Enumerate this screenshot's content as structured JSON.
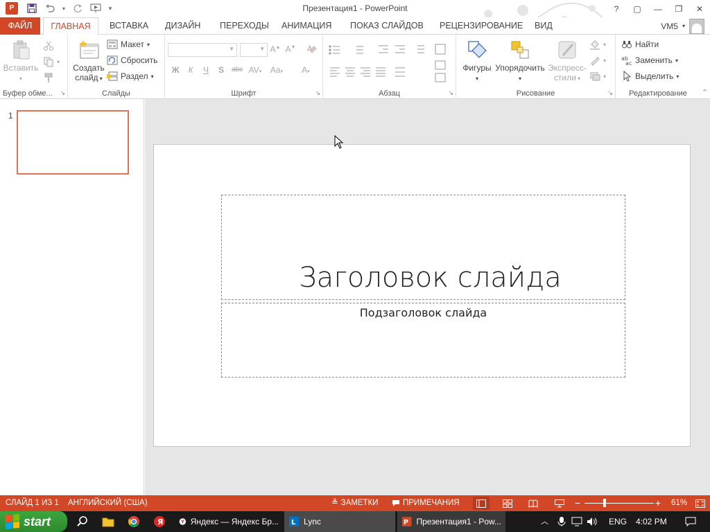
{
  "window": {
    "title": "Презентация1 - PowerPoint",
    "logo": "P",
    "controls": [
      "?",
      "▢",
      "—",
      "❐",
      "✕"
    ]
  },
  "tabs": {
    "file": "ФАЙЛ",
    "items": [
      "ГЛАВНАЯ",
      "ВСТАВКА",
      "ДИЗАЙН",
      "ПЕРЕХОДЫ",
      "АНИМАЦИЯ",
      "ПОКАЗ СЛАЙДОВ",
      "РЕЦЕНЗИРОВАНИЕ",
      "ВИД"
    ],
    "active": "ГЛАВНАЯ",
    "user": "VM5"
  },
  "ribbon": {
    "clipboard": {
      "label": "Буфер обме...",
      "paste": "Вставить"
    },
    "slides": {
      "label": "Слайды",
      "new_slide_line1": "Создать",
      "new_slide_line2": "слайд",
      "layout": "Макет",
      "reset": "Сбросить",
      "section": "Раздел"
    },
    "font": {
      "label": "Шрифт",
      "bold": "Ж",
      "italic": "К",
      "underline": "Ч",
      "shadow": "S",
      "strike": "abc",
      "spacing": "AV",
      "case": "Aa",
      "color": "A"
    },
    "paragraph": {
      "label": "Абзац"
    },
    "drawing": {
      "label": "Рисование",
      "shapes": "Фигуры",
      "arrange": "Упорядочить",
      "quick_styles_line1": "Экспресс-",
      "quick_styles_line2": "стили"
    },
    "editing": {
      "label": "Редактирование",
      "find": "Найти",
      "replace": "Заменить",
      "select": "Выделить"
    }
  },
  "thumbnails": [
    {
      "number": "1"
    }
  ],
  "slide": {
    "title": "Заголовок слайда",
    "subtitle": "Подзаголовок слайда"
  },
  "status": {
    "slide_info": "СЛАЙД 1 ИЗ 1",
    "language": "АНГЛИЙСКИЙ (США)",
    "notes": "ЗАМЕТКИ",
    "comments": "ПРИМЕЧАНИЯ",
    "zoom": "61%",
    "zoom_minus": "−",
    "zoom_plus": "+"
  },
  "taskbar": {
    "start": "start",
    "items": [
      {
        "label": "Яндекс — Яндекс Бр..."
      },
      {
        "label": "Lync"
      },
      {
        "label": "Презентация1 - Pow..."
      }
    ],
    "language": "ENG",
    "time": "4:02 PM"
  },
  "colors": {
    "accent": "#d24726",
    "taskbar": "#1a1a1a",
    "start": "#3da53d"
  }
}
